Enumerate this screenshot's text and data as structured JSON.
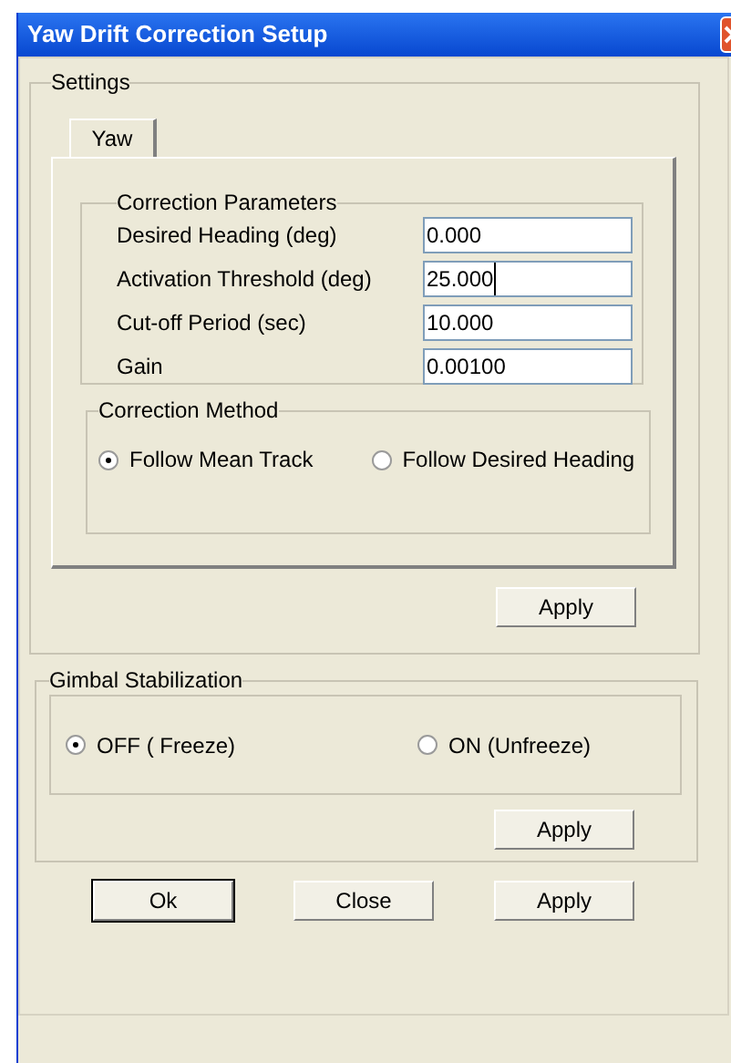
{
  "window": {
    "title": "Yaw Drift Correction Setup"
  },
  "settings": {
    "title": "Settings",
    "tabs": [
      {
        "label": "Yaw",
        "selected": true
      }
    ],
    "parameters": {
      "title": "Correction Parameters",
      "fields": [
        {
          "label": "Desired Heading (deg)",
          "value": "0.000",
          "focused": false
        },
        {
          "label": "Activation Threshold (deg)",
          "value": "25.000",
          "focused": true
        },
        {
          "label": "Cut-off Period (sec)",
          "value": "10.000",
          "focused": false
        },
        {
          "label": "Gain",
          "value": "0.00100",
          "focused": false
        }
      ]
    },
    "method": {
      "title": "Correction Method",
      "options": [
        {
          "label": "Follow Mean Track",
          "selected": true
        },
        {
          "label": "Follow Desired Heading",
          "selected": false
        }
      ]
    },
    "apply": "Apply"
  },
  "gimbal": {
    "title": "Gimbal Stabilization",
    "options": [
      {
        "label": "OFF ( Freeze)",
        "selected": true
      },
      {
        "label": "ON  (Unfreeze)",
        "selected": false
      }
    ],
    "apply": "Apply"
  },
  "buttons": [
    {
      "label": "Ok",
      "default": true
    },
    {
      "label": "Close",
      "default": false
    },
    {
      "label": "Apply",
      "default": false
    }
  ]
}
